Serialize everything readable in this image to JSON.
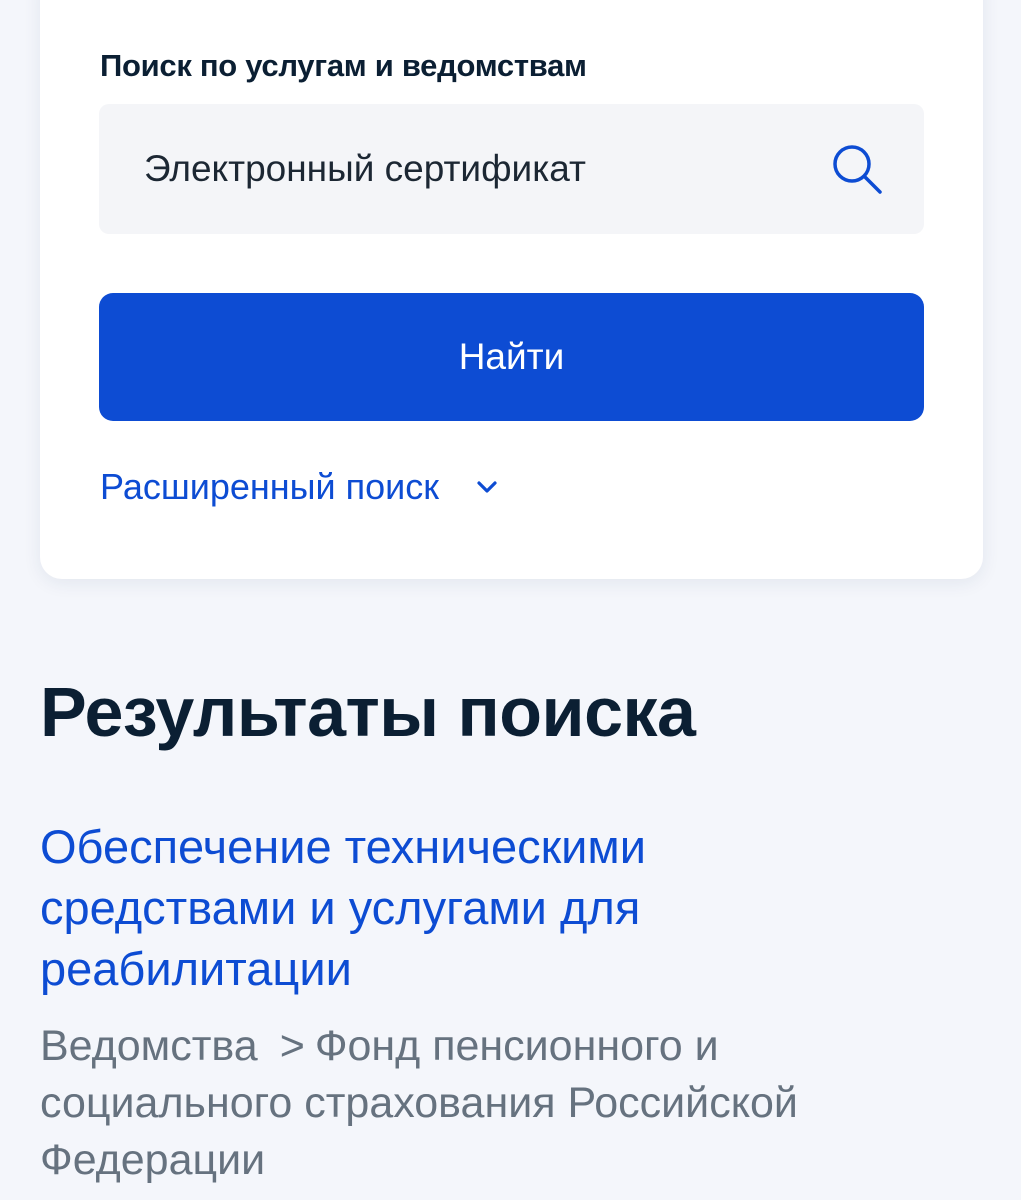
{
  "search_panel": {
    "label": "Поиск по услугам и ведомствам",
    "query_value": "Электронный сертификат",
    "search_icon": "search-icon",
    "find_button_label": "Найти",
    "advanced_search_label": "Расширенный поиск",
    "advanced_icon": "chevron-down-icon"
  },
  "results": {
    "title": "Результаты поиска",
    "items": [
      {
        "title": "Обеспечение техническими средствами и услугами для реабилитации",
        "breadcrumb_root": "Ведомства",
        "breadcrumb_separator": ">",
        "breadcrumb_target": "Фонд пенсионного и социального страхования Российской Федерации"
      }
    ]
  },
  "colors": {
    "accent": "#0d4cd3",
    "heading": "#0b1f33",
    "muted": "#66727f",
    "background": "#f4f6fb",
    "field_background": "#f4f5f8"
  }
}
